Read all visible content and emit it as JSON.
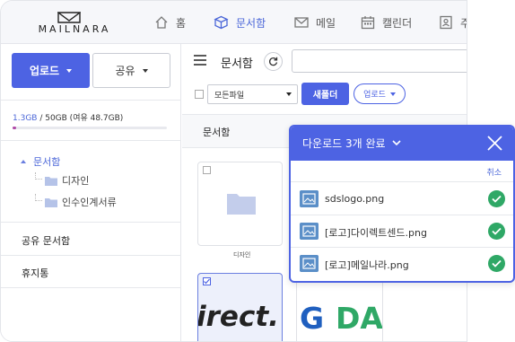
{
  "app": {
    "logo_text": "MAILNARA",
    "accent_color": "#4d63e3"
  },
  "nav": {
    "items": [
      {
        "label": "홈",
        "icon": "home-icon"
      },
      {
        "label": "문서함",
        "icon": "cube-icon",
        "active": true
      },
      {
        "label": "메일",
        "icon": "mail-icon"
      },
      {
        "label": "캘린더",
        "icon": "calendar-icon"
      },
      {
        "label": "주",
        "icon": "contacts-icon"
      }
    ]
  },
  "sidebar": {
    "upload_label": "업로드",
    "share_label": "공유",
    "storage_used": "1.3GB",
    "storage_rest": " / 50GB (여유 48.7GB)",
    "storage_ratio": 0.026,
    "tree_root": "문서함",
    "tree_children": [
      "디자인",
      "인수인계서류"
    ],
    "shared_label": "공유 문서함",
    "trash_label": "휴지통"
  },
  "main": {
    "title": "문서함",
    "filter_value": "모든파일",
    "new_folder_label": "새폴더",
    "upload_label": "업로드",
    "list_header": "문서함",
    "folder_caption": "디자인",
    "thumb1_text": "irect.",
    "thumb2_text_g": "G",
    "thumb2_text_da": "DA"
  },
  "download_panel": {
    "title": "다운로드 3개 완료",
    "cancel_label": "취소",
    "files": [
      "sdslogo.png",
      "[로고]다이렉트센드.png",
      "[로고]메일나라.png"
    ],
    "success_color": "#2fa866"
  }
}
